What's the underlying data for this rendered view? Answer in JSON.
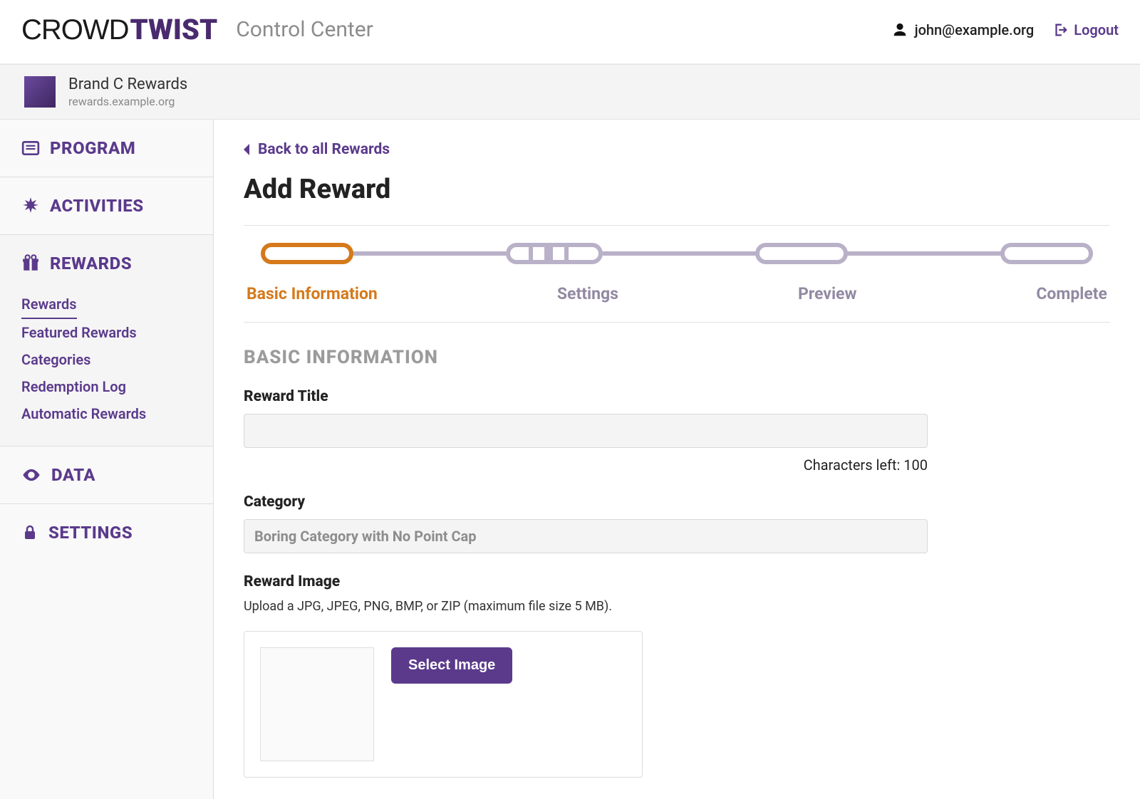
{
  "header": {
    "logo_light": "CROWD",
    "logo_bold": "TWIST",
    "subtitle": "Control Center",
    "user_email": "john@example.org",
    "logout_label": "Logout"
  },
  "brand": {
    "name": "Brand C Rewards",
    "domain": "rewards.example.org"
  },
  "sidebar": {
    "items": [
      {
        "label": "PROGRAM",
        "icon": "list-icon"
      },
      {
        "label": "ACTIVITIES",
        "icon": "burst-icon"
      },
      {
        "label": "REWARDS",
        "icon": "gift-icon",
        "children": [
          {
            "label": "Rewards",
            "current": true
          },
          {
            "label": "Featured Rewards"
          },
          {
            "label": "Categories"
          },
          {
            "label": "Redemption Log"
          },
          {
            "label": "Automatic Rewards"
          }
        ]
      },
      {
        "label": "DATA",
        "icon": "eye-icon"
      },
      {
        "label": "SETTINGS",
        "icon": "lock-icon"
      }
    ]
  },
  "page": {
    "back_label": "Back to all Rewards",
    "title": "Add Reward",
    "steps": [
      {
        "label": "Basic Information",
        "active": true
      },
      {
        "label": "Settings"
      },
      {
        "label": "Preview"
      },
      {
        "label": "Complete"
      }
    ],
    "section_title": "BASIC INFORMATION",
    "fields": {
      "title_label": "Reward Title",
      "title_value": "",
      "chars_left": "Characters left: 100",
      "category_label": "Category",
      "category_value": "Boring Category with No Point Cap",
      "image_label": "Reward Image",
      "image_hint": "Upload a JPG, JPEG, PNG, BMP, or ZIP (maximum file size 5 MB).",
      "select_image_label": "Select Image"
    }
  }
}
